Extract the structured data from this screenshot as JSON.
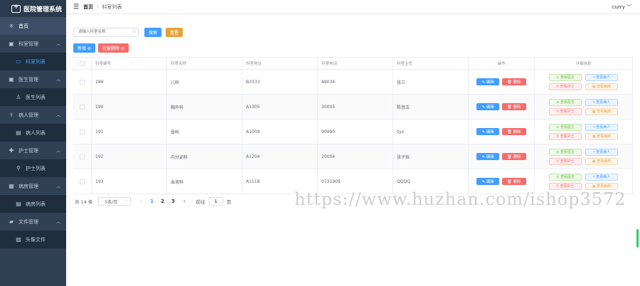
{
  "app": {
    "title": "医院管理系统"
  },
  "header": {
    "breadcrumb_home": "首页",
    "breadcrumb_sep": "/",
    "breadcrumb_current": "科室列表",
    "user": "curry ﹀"
  },
  "sidebar": {
    "items": [
      {
        "icon": "⌾",
        "label": "首页",
        "type": "home"
      },
      {
        "icon": "▣",
        "label": "科室管理",
        "type": "group"
      },
      {
        "icon": "▭",
        "label": "科室列表",
        "type": "sub-active"
      },
      {
        "icon": "▣",
        "label": "医生管理",
        "type": "group"
      },
      {
        "icon": "♙",
        "label": "医生列表",
        "type": "sub"
      },
      {
        "icon": "⚕",
        "label": "病人管理",
        "type": "group"
      },
      {
        "icon": "▤",
        "label": "病人列表",
        "type": "sub"
      },
      {
        "icon": "✚",
        "label": "护士管理",
        "type": "group"
      },
      {
        "icon": "⚲",
        "label": "护士列表",
        "type": "sub"
      },
      {
        "icon": "▦",
        "label": "病房管理",
        "type": "group"
      },
      {
        "icon": "▤",
        "label": "病房列表",
        "type": "sub"
      },
      {
        "icon": "▰",
        "label": "文件管理",
        "type": "group"
      },
      {
        "icon": "▨",
        "label": "头像文件",
        "type": "sub"
      }
    ]
  },
  "toolbar": {
    "search_placeholder": "请输入科室名称",
    "search_label": "搜索",
    "reset_label": "重置",
    "add_label": "新增 ⊕",
    "batch_delete_label": "批量删除 ⊖"
  },
  "table": {
    "headers": [
      "科室编号",
      "科室名称",
      "科室地址",
      "科室电话",
      "科室主任",
      "操作",
      "详细信息"
    ],
    "edit_label": "✎ 编辑",
    "delete_label": "🗑 删除",
    "detail_tags": {
      "doctor": "♙ 查看医生",
      "patient": "⚕ 查看病人",
      "nurse": "⚲ 查看护士",
      "ward": "▦ 查看病房"
    },
    "rows": [
      {
        "id": "189",
        "name": "儿科",
        "addr": "B3333",
        "phone": "89034",
        "director": "张三"
      },
      {
        "id": "190",
        "name": "胸外科",
        "addr": "A1305",
        "phone": "30005",
        "director": "陈翁玉"
      },
      {
        "id": "191",
        "name": "骨科",
        "addr": "A1009",
        "phone": "90990",
        "director": "zyx"
      },
      {
        "id": "192",
        "name": "内分泌科",
        "addr": "A1204",
        "phone": "20004",
        "director": "张子怡"
      },
      {
        "id": "193",
        "name": "血液科",
        "addr": "A1118",
        "phone": "0731909",
        "director": "QQQQ"
      }
    ]
  },
  "pagination": {
    "total": "共 14 条",
    "page_size": "5条/页",
    "pages": [
      "1",
      "2",
      "3"
    ],
    "current": "1",
    "goto_label": "前往",
    "goto_value": "1",
    "page_unit": "页"
  },
  "watermark": "https://www.huzhan.com/ishop3572"
}
